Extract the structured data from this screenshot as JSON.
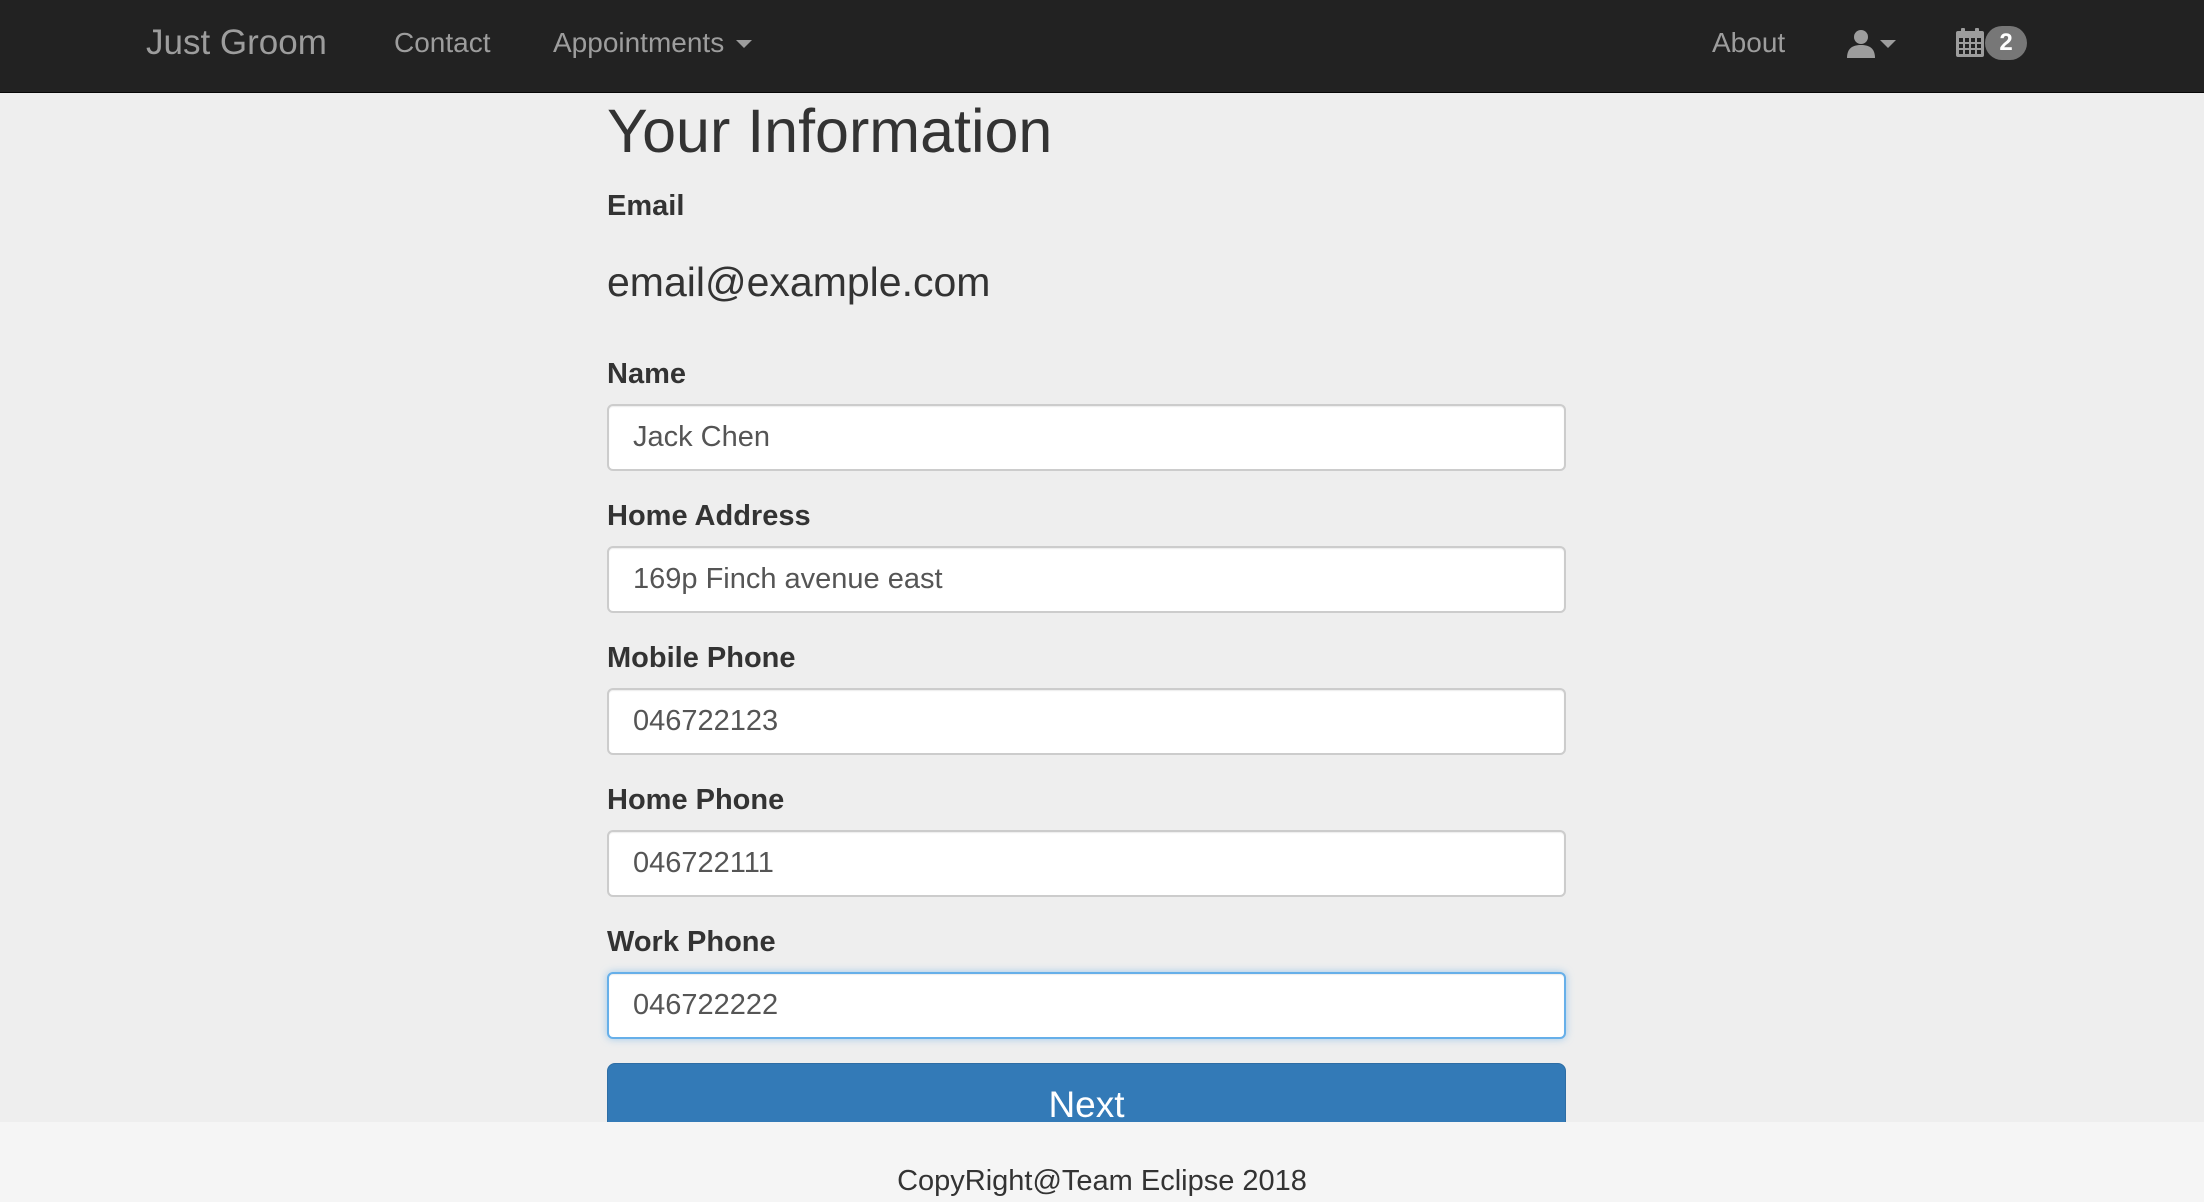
{
  "navbar": {
    "brand": "Just Groom",
    "contact": "Contact",
    "appointments": "Appointments",
    "about": "About",
    "user_icon": "user-icon",
    "calendar_icon": "calendar-icon",
    "calendar_badge": "2"
  },
  "form": {
    "title": "Your Information",
    "email": {
      "label": "Email",
      "value": "email@example.com"
    },
    "name": {
      "label": "Name",
      "value": "Jack Chen"
    },
    "home_address": {
      "label": "Home Address",
      "value": "169p Finch avenue east"
    },
    "mobile_phone": {
      "label": "Mobile Phone",
      "value": "046722123"
    },
    "home_phone": {
      "label": "Home Phone",
      "value": "046722111"
    },
    "work_phone": {
      "label": "Work Phone",
      "value": "046722222"
    },
    "next_label": "Next"
  },
  "footer": {
    "text": "CopyRight@Team Eclipse 2018"
  },
  "colors": {
    "navbar_bg": "#222222",
    "navbar_text": "#9d9d9d",
    "page_bg": "#eeeeee",
    "primary_button": "#337ab7",
    "badge_bg": "#777777",
    "focus_border": "#66afe9"
  }
}
